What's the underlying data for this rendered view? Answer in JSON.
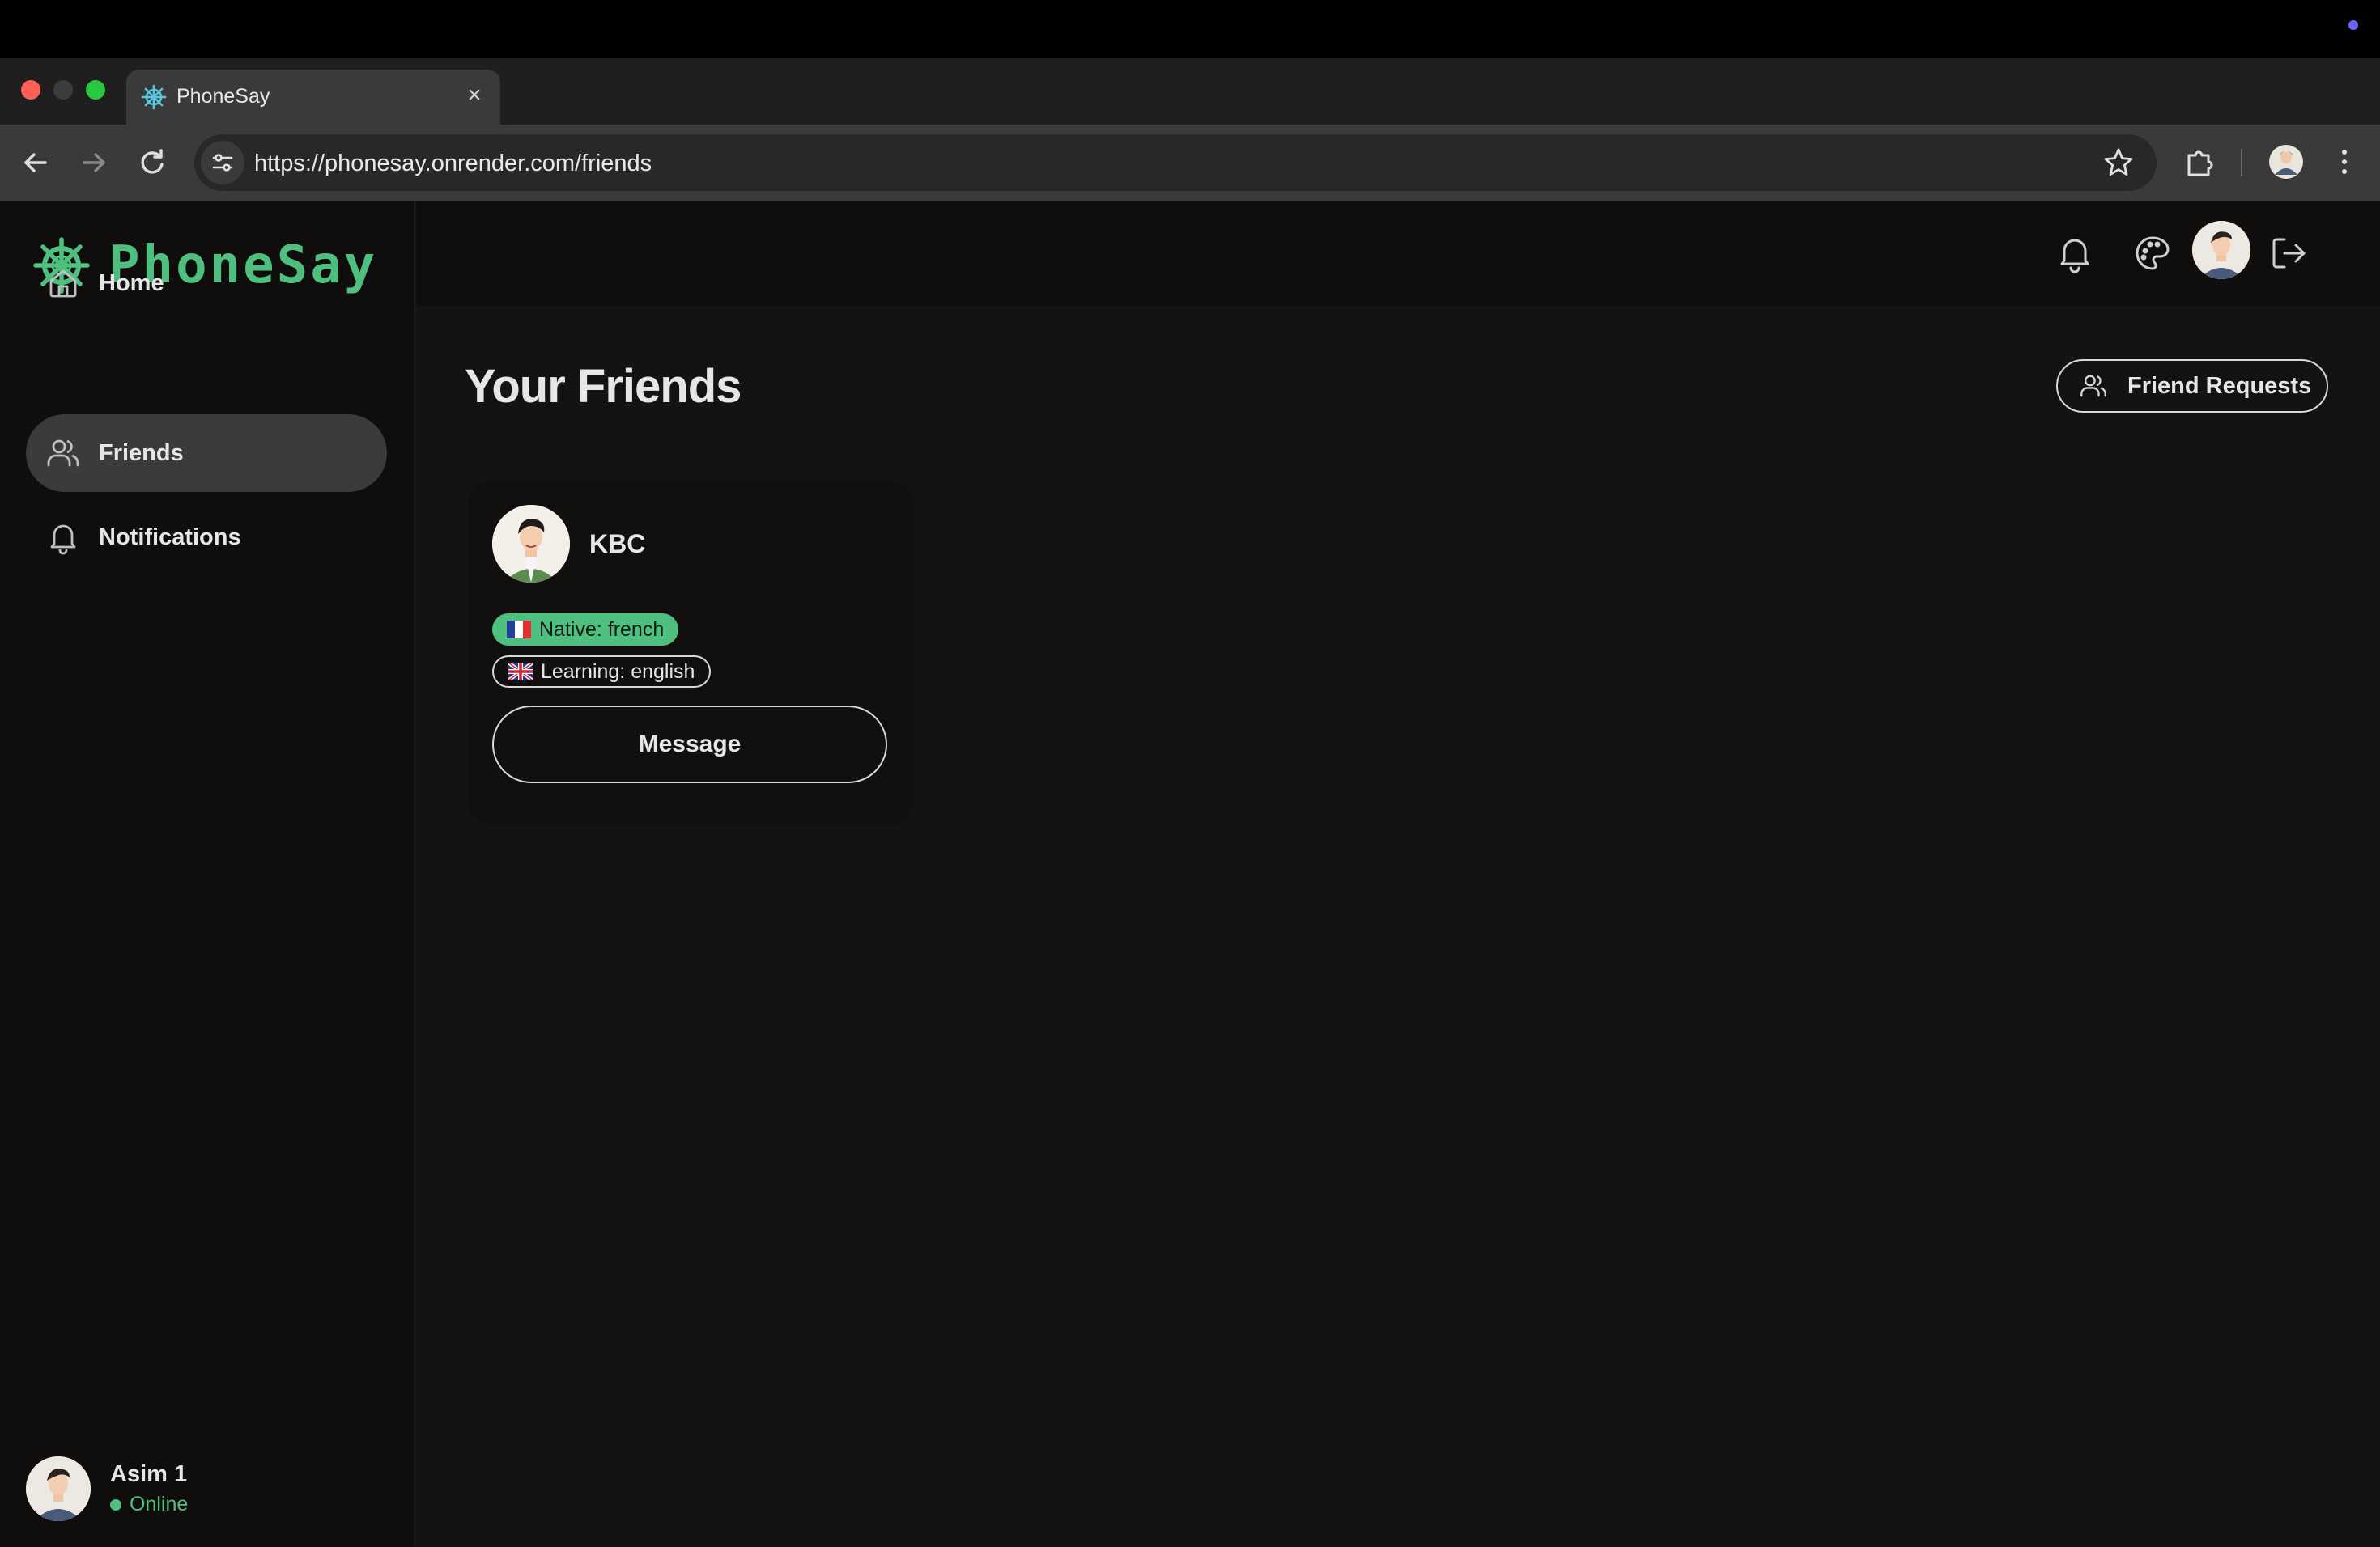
{
  "browser": {
    "tab_title": "PhoneSay",
    "tab_close": "×",
    "new_tab": "+",
    "url": "https://phonesay.onrender.com/friends"
  },
  "app": {
    "brand": "PhoneSay",
    "accent_color": "#4fbf80"
  },
  "sidebar": {
    "items": [
      {
        "label": "Home",
        "icon": "home-icon"
      },
      {
        "label": "Friends",
        "icon": "users-icon",
        "active": true
      },
      {
        "label": "Notifications",
        "icon": "bell-icon"
      }
    ],
    "user": {
      "name": "Asim 1",
      "status": "Online"
    }
  },
  "header": {
    "icons": [
      "bell-icon",
      "palette-icon",
      "avatar",
      "logout-icon"
    ]
  },
  "main": {
    "title": "Your Friends",
    "requests_button": "Friend Requests",
    "friends": [
      {
        "name": "KBC",
        "native": "Native: french",
        "learning": "Learning: english",
        "action": "Message"
      }
    ]
  }
}
